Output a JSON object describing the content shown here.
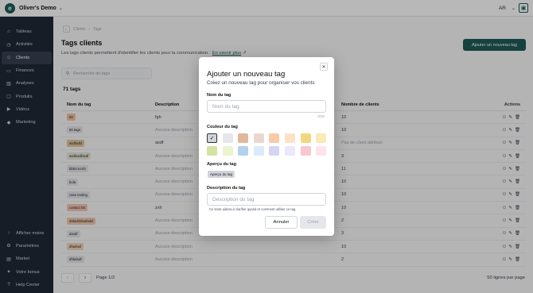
{
  "topbar": {
    "workspace": "Oliver's Demo",
    "user_initials": "AR"
  },
  "sidebar": {
    "items": [
      {
        "label": "Tableau",
        "icon": "home-icon",
        "glyph": "⌂"
      },
      {
        "label": "Activités",
        "icon": "activity-icon",
        "glyph": "◷"
      },
      {
        "label": "Clients",
        "icon": "users-icon",
        "glyph": "☺"
      },
      {
        "label": "Finances",
        "icon": "finance-icon",
        "glyph": "▭"
      },
      {
        "label": "Analyses",
        "icon": "chart-icon",
        "glyph": "▥"
      },
      {
        "label": "Produits",
        "icon": "box-icon",
        "glyph": "▢"
      },
      {
        "label": "Vidéos",
        "icon": "video-icon",
        "glyph": "▶"
      },
      {
        "label": "Marketing",
        "icon": "megaphone-icon",
        "glyph": "◆"
      }
    ],
    "bottom": [
      {
        "label": "Afficher moins",
        "icon": "collapse-icon",
        "glyph": "↑"
      },
      {
        "label": "Paramètres",
        "icon": "gear-icon",
        "glyph": "⚙"
      },
      {
        "label": "Market",
        "icon": "store-icon",
        "glyph": "▤"
      },
      {
        "label": "Votre bonus",
        "icon": "gift-icon",
        "glyph": "✦"
      },
      {
        "label": "Help Center",
        "icon": "help-icon",
        "glyph": "?"
      }
    ]
  },
  "breadcrumb": {
    "parent": "Clients",
    "current": "Tags"
  },
  "page": {
    "title": "Tags clients",
    "subtitle": "Les tags clients permettent d'identifier les clients pour la communication.",
    "learn_more": "En savoir plus",
    "add_button": "Ajouter un nouveau tag",
    "search_placeholder": "Recherche de tags",
    "count": "71 tags"
  },
  "table": {
    "headers": {
      "name": "Nom du tag",
      "description": "Description",
      "clients": "Nombre de clients",
      "actions": "Actions"
    },
    "rows": [
      {
        "tag": "50",
        "color": "#f4c3a1",
        "description": "fgh",
        "clients": "10"
      },
      {
        "tag": "50 tags",
        "color": "#e5e7eb",
        "description": "Aucune description",
        "clients": "10"
      },
      {
        "tag": "asdfadsf",
        "color": "#e2c89a",
        "description": "asdf",
        "clients": "Pas de client attribué"
      },
      {
        "tag": "asdfasdfasdf",
        "color": "#e7e7d8",
        "description": "Aucune description",
        "clients": "3"
      },
      {
        "tag": "bbbcnccnb",
        "color": "#e5e7eb",
        "description": "Aucune description",
        "clients": "11"
      },
      {
        "tag": "bola",
        "color": "#e5e7eb",
        "description": "Aucune description",
        "clients": "10"
      },
      {
        "tag": "case testing",
        "color": "#e5e7eb",
        "description": "Aucune description",
        "clients": "10"
      },
      {
        "tag": "contact list",
        "color": "#f7c7b5",
        "description": "zxh",
        "clients": "10"
      },
      {
        "tag": "dafadsfdsafadsf",
        "color": "#f4cbb0",
        "description": "Aucune description",
        "clients": "2"
      },
      {
        "tag": "dasdf",
        "color": "#e5e7eb",
        "description": "Aucune description",
        "clients": "3"
      },
      {
        "tag": "dfasfasf",
        "color": "#f3d6b8",
        "description": "Aucune description",
        "clients": "10"
      },
      {
        "tag": "dfdafadf",
        "color": "#e5e7eb",
        "description": "Aucune description",
        "clients": "2"
      }
    ]
  },
  "pagination": {
    "page_label": "Page 1/2",
    "per_page": "50 lignes par page"
  },
  "modal": {
    "title": "Ajouter un nouveau tag",
    "subtitle": "Créez un nouveau tag pour organiser vos clients",
    "name_label": "Nom du tag",
    "name_placeholder": "Nom du tag",
    "name_counter": "0/20",
    "color_label": "Couleur du tag",
    "colors": [
      "#d1d5db",
      "#e5e7eb",
      "#e0b89a",
      "#ead8cf",
      "#f8cba8",
      "#fde0c8",
      "#f3d77e",
      "#f9eab6",
      "#d4e3a0",
      "#eaf4cf",
      "#b4d0ef",
      "#dbeafc",
      "#d6d4f3",
      "#eae8fb",
      "#f8c7d0",
      "#fde3ea"
    ],
    "selected_color_index": 0,
    "preview_label": "Aperçu du tag",
    "preview_text": "Aperçu du tag",
    "description_label": "Description du tag",
    "description_placeholder": "Description du tag",
    "description_hint": "Ce texte aidera à clarifier quand et comment utiliser ce tag.",
    "cancel": "Annuler",
    "create": "Créer"
  }
}
